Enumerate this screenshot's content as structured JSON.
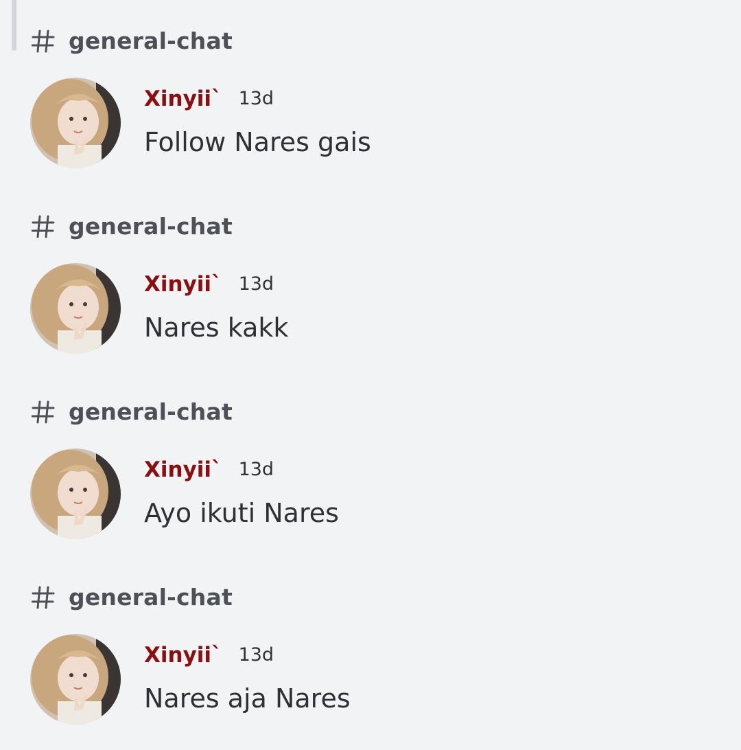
{
  "messages": [
    {
      "channel": "general-chat",
      "author": "Xinyii`",
      "time": "13d",
      "text": "Follow Nares gais",
      "avatar_icon": "user-avatar-photo"
    },
    {
      "channel": "general-chat",
      "author": "Xinyii`",
      "time": "13d",
      "text": "Nares kakk",
      "avatar_icon": "user-avatar-photo"
    },
    {
      "channel": "general-chat",
      "author": "Xinyii`",
      "time": "13d",
      "text": "Ayo ikuti Nares",
      "avatar_icon": "user-avatar-photo"
    },
    {
      "channel": "general-chat",
      "author": "Xinyii`",
      "time": "13d",
      "text": "Nares aja Nares",
      "avatar_icon": "user-avatar-photo"
    }
  ],
  "colors": {
    "background": "#f2f3f5",
    "channel_text": "#4e5058",
    "username": "#8b0f10",
    "message_text": "#2e3035"
  }
}
